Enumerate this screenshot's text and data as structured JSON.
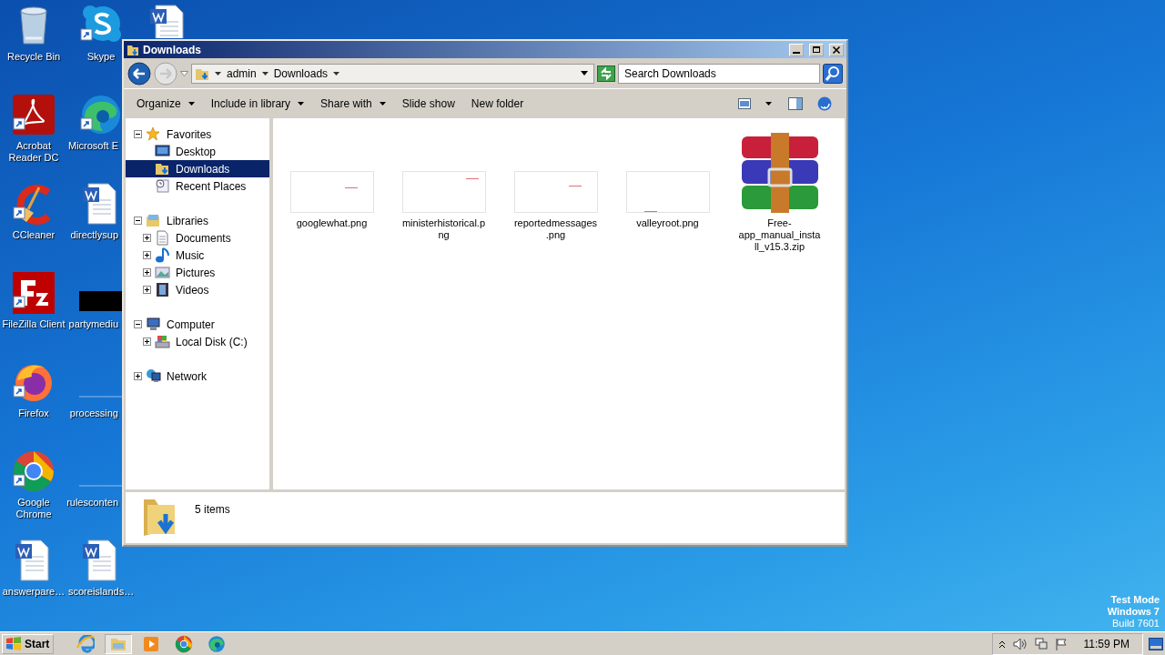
{
  "desktop": {
    "icons": [
      {
        "label": "Recycle Bin",
        "kind": "recycle",
        "shortcut": false
      },
      {
        "label": "Acrobat Reader DC",
        "kind": "acrobat",
        "shortcut": true
      },
      {
        "label": "CCleaner",
        "kind": "ccleaner",
        "shortcut": true
      },
      {
        "label": "FileZilla Client",
        "kind": "filezilla",
        "shortcut": true
      },
      {
        "label": "Firefox",
        "kind": "firefox",
        "shortcut": true
      },
      {
        "label": "Google Chrome",
        "kind": "chrome",
        "shortcut": true
      },
      {
        "label": "answerpare…",
        "kind": "word",
        "shortcut": false
      },
      {
        "label": "Skype",
        "kind": "skype",
        "shortcut": true
      },
      {
        "label": "Microsoft E",
        "kind": "edge",
        "shortcut": true
      },
      {
        "label": "directlysup",
        "kind": "word",
        "shortcut": false
      },
      {
        "label": "partymediu",
        "kind": "dark",
        "shortcut": false
      },
      {
        "label": "processing",
        "kind": "blank",
        "shortcut": false
      },
      {
        "label": "rulesconten",
        "kind": "blank",
        "shortcut": false
      },
      {
        "label": "scoreislands…",
        "kind": "word",
        "shortcut": false
      },
      {
        "kind": "word",
        "shortcut": false
      }
    ],
    "watermark": [
      "Test Mode",
      "Windows 7",
      "Build 7601"
    ]
  },
  "window": {
    "title": "Downloads",
    "address": {
      "crumbs": [
        "admin",
        "Downloads"
      ]
    },
    "search": {
      "placeholder": "Search Downloads"
    },
    "toolbar": [
      {
        "label": "Organize",
        "kind": "menu"
      },
      {
        "label": "Include in library",
        "kind": "menu"
      },
      {
        "label": "Share with",
        "kind": "menu"
      },
      {
        "label": "Slide show",
        "kind": "command"
      },
      {
        "label": "New folder",
        "kind": "command"
      }
    ],
    "nav": [
      {
        "label": "Favorites",
        "kind": "star",
        "expanded": true,
        "selected": false,
        "children": [
          {
            "label": "Desktop",
            "kind": "desktop",
            "selected": false
          },
          {
            "label": "Downloads",
            "kind": "downloads",
            "selected": true
          },
          {
            "label": "Recent Places",
            "kind": "recent",
            "selected": false
          }
        ]
      },
      {
        "label": "Libraries",
        "kind": "library",
        "expanded": true,
        "selected": false,
        "children": [
          {
            "label": "Documents",
            "kind": "documents",
            "expanded": false,
            "selected": false
          },
          {
            "label": "Music",
            "kind": "music",
            "expanded": false,
            "selected": false
          },
          {
            "label": "Pictures",
            "kind": "pictures",
            "expanded": false,
            "selected": false
          },
          {
            "label": "Videos",
            "kind": "videos",
            "expanded": false,
            "selected": false
          }
        ]
      },
      {
        "label": "Computer",
        "kind": "computer",
        "expanded": true,
        "selected": false,
        "children": [
          {
            "label": "Local Disk (C:)",
            "kind": "disk",
            "expanded": false,
            "selected": false
          }
        ]
      },
      {
        "label": "Network",
        "kind": "network",
        "expanded": false,
        "selected": false
      }
    ],
    "files": [
      {
        "name": "googlewhat.png",
        "kind": "image"
      },
      {
        "name": "ministerhistorical.png",
        "kind": "image"
      },
      {
        "name": "reportedmessages.png",
        "kind": "image"
      },
      {
        "name": "valleyroot.png",
        "kind": "image"
      },
      {
        "name": "Free-app_manual_install_v15.3.zip",
        "kind": "archive"
      }
    ],
    "status_bar": {
      "count": "5 items"
    }
  },
  "taskbar": {
    "start": "Start",
    "apps": [
      {
        "kind": "ie",
        "selected": false
      },
      {
        "kind": "explorer",
        "selected": true
      },
      {
        "kind": "media",
        "selected": false
      },
      {
        "kind": "chrome",
        "selected": false
      },
      {
        "kind": "edge",
        "selected": false
      }
    ],
    "clock": "11:59 PM"
  }
}
